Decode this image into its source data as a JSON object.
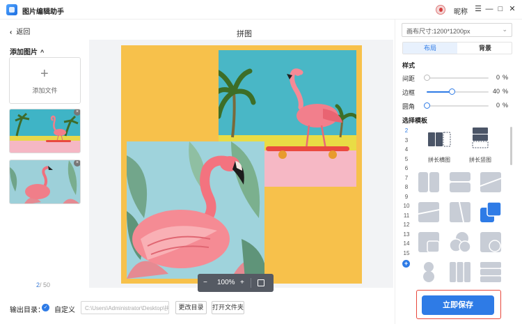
{
  "app": {
    "title": "图片编辑助手",
    "nickname": "昵称"
  },
  "window_controls": {
    "menu": "☰",
    "minimize": "—",
    "maximize": "□",
    "close": "✕"
  },
  "nav": {
    "back_label": "返回",
    "back_icon": "‹",
    "canvas_title": "拼图"
  },
  "sidebar": {
    "section_label": "添加图片",
    "section_caret": "^",
    "add_file_plus": "+",
    "add_file_label": "添加文件",
    "remove_icon": "×",
    "count_current": "2",
    "count_total": "/ 50"
  },
  "zoom": {
    "minus": "−",
    "value": "100%",
    "plus": "+"
  },
  "output": {
    "label": "输出目录：",
    "check": "✓",
    "mode_label": "自定义",
    "path": "C:\\Users\\Administrator\\Desktop\\拼",
    "change_dir_label": "更改目录",
    "open_folder_label": "打开文件夹"
  },
  "right_panel": {
    "canvas_size": "画布尺寸:1200*1200px",
    "dropdown_icon": "⌄",
    "tabs": [
      "布局",
      "背景"
    ],
    "style_label": "样式",
    "sliders": [
      {
        "label": "间距",
        "value": 0,
        "value_text": "0",
        "unit": "%",
        "fraction": 0.0
      },
      {
        "label": "边框",
        "value": 40,
        "value_text": "40",
        "unit": "%",
        "fraction": 0.4
      },
      {
        "label": "圆角",
        "value": 0,
        "value_text": "0",
        "unit": "%",
        "fraction": 0.0
      }
    ],
    "template_label": "选择模板",
    "template_numbers": [
      "2",
      "3",
      "4",
      "5",
      "6",
      "7",
      "8",
      "9",
      "10",
      "11",
      "12",
      "13",
      "14",
      "15"
    ],
    "active_number": "2",
    "add_template": "+",
    "big_templates": [
      "拼长横图",
      "拼长竖图"
    ],
    "save_label": "立即保存"
  },
  "colors": {
    "accent": "#2e7be6",
    "board": "#f7c14b",
    "save_frame": "#e8463a"
  }
}
